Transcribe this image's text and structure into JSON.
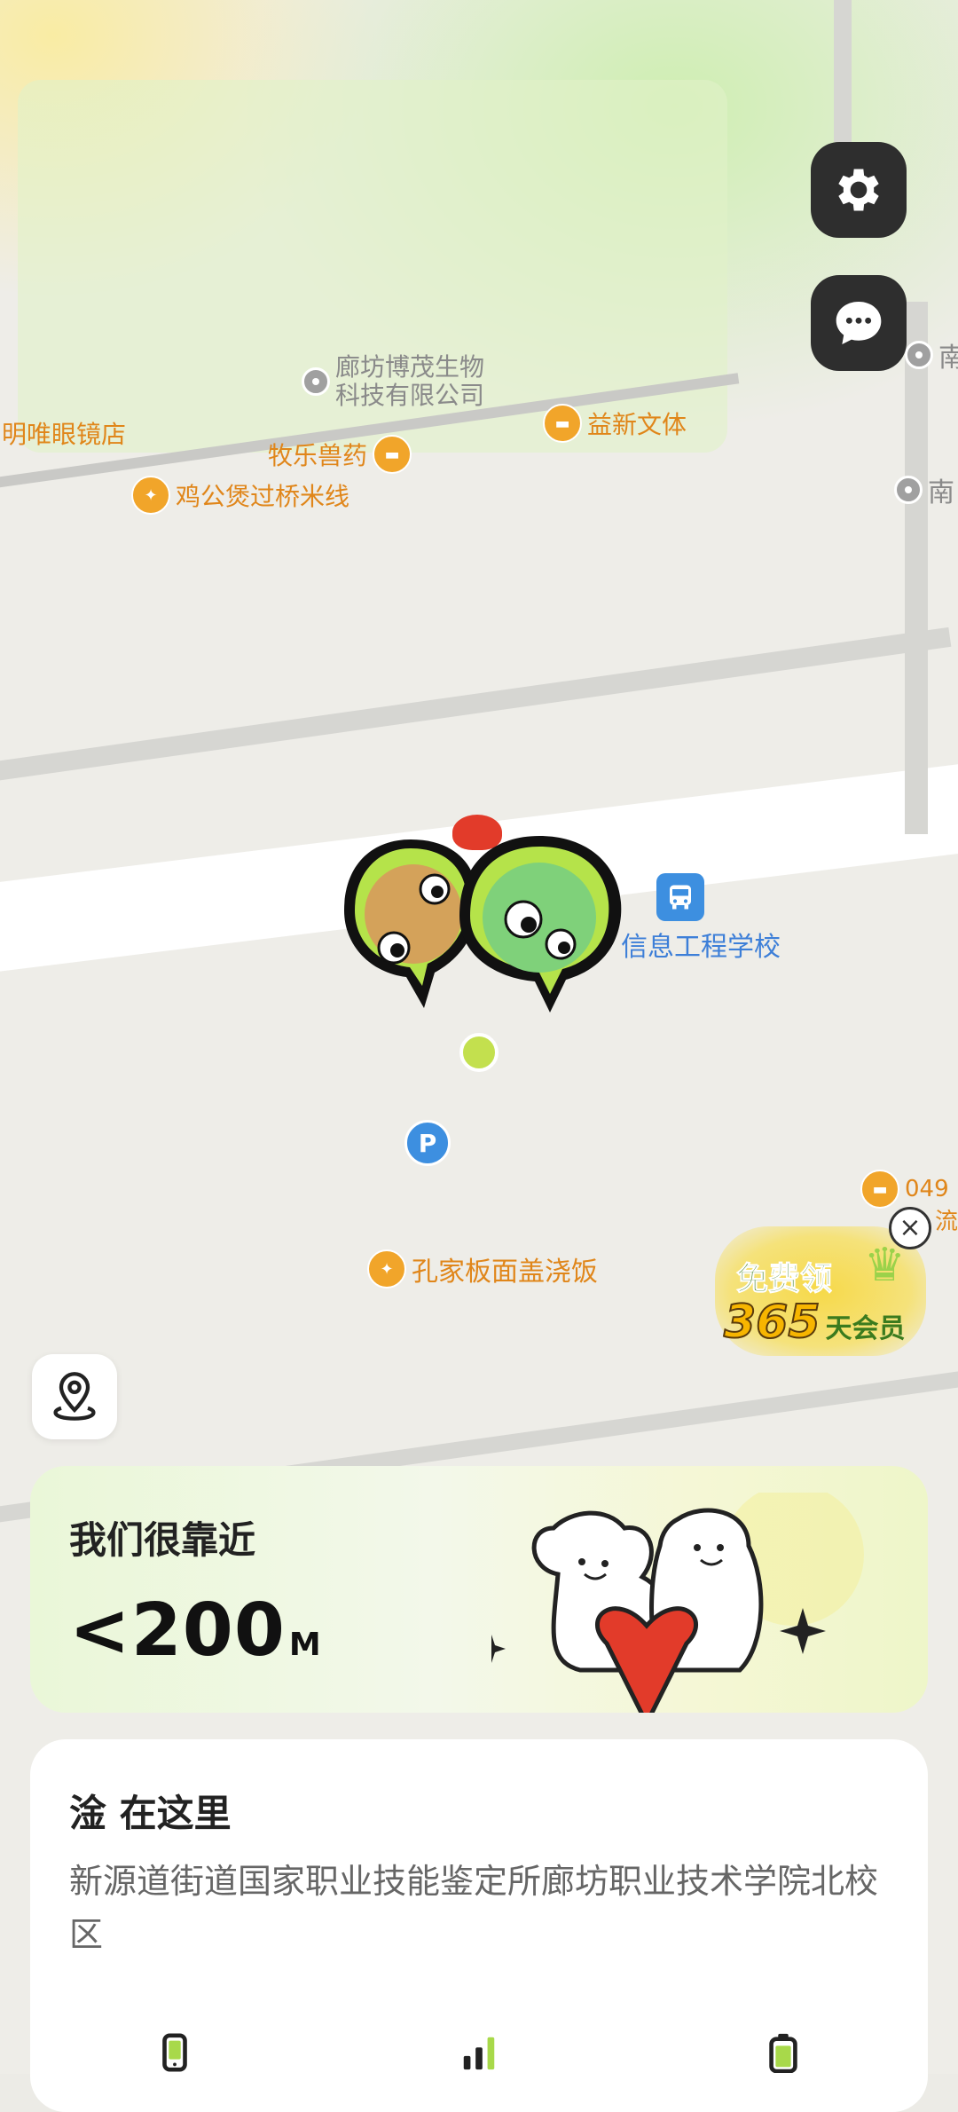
{
  "map": {
    "pois": {
      "langfang_bio": "廊坊博茂生物\n科技有限公司",
      "glasses": "明唯眼镜店",
      "muyao": "牧乐兽药",
      "yixin": "益新文体",
      "jigong": "鸡公煲过桥米线",
      "xinxi_school": "信息工程学校",
      "kongjia": "孔家板面盖浇饭",
      "nan1": "南",
      "nan2": "南",
      "partial_049": "049",
      "partial_liu": "流"
    },
    "parking_label": "P"
  },
  "promo": {
    "line1": "免费领",
    "line2": "365",
    "line3": "天会员"
  },
  "distance_card": {
    "title": "我们很靠近",
    "value": "<200",
    "unit": "M"
  },
  "location_card": {
    "name": "淦 在这里",
    "address": "新源道街道国家职业技能鉴定所廊坊职业技术学院北校区"
  },
  "icons": {
    "settings": "gear-icon",
    "chat": "chat-icon",
    "locate": "location-pin-icon",
    "phone": "phone-icon",
    "signal": "signal-icon",
    "battery": "battery-icon"
  },
  "colors": {
    "accent_green": "#a8d94a",
    "poi_orange": "#e0861a",
    "poi_blue": "#3d7fd8",
    "dark_button": "#2e2e2e"
  }
}
